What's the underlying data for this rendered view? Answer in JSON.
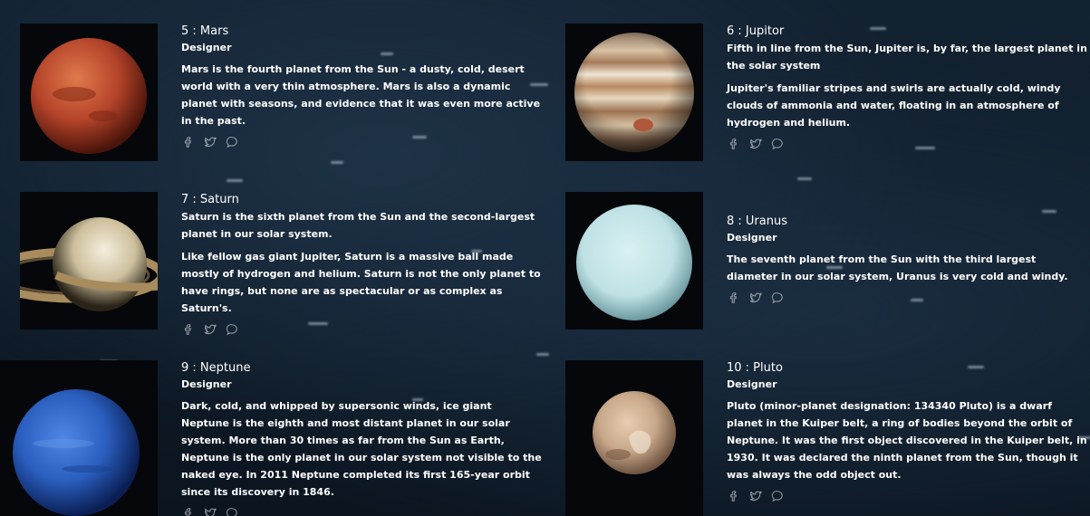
{
  "cards": [
    {
      "title": "5 : Mars",
      "role": "Designer",
      "paragraphs": [
        "Mars is the fourth planet from the Sun - a dusty, cold, desert world with a very thin atmosphere. Mars is also a dynamic planet with seasons, and evidence that it was even more active in the past."
      ]
    },
    {
      "title": "6 : Jupitor",
      "paragraphs": [
        "Fifth in line from the Sun, Jupiter is, by far, the largest planet in the solar system",
        "Jupiter's familiar stripes and swirls are actually cold, windy clouds of ammonia and water, floating in an atmosphere of hydrogen and helium."
      ]
    },
    {
      "title": "7 : Saturn",
      "paragraphs": [
        "Saturn is the sixth planet from the Sun and the second-largest planet in our solar system.",
        "Like fellow gas giant Jupiter, Saturn is a massive ball made mostly of hydrogen and helium. Saturn is not the only planet to have rings, but none are as spectacular or as complex as Saturn's."
      ]
    },
    {
      "title": "8 : Uranus",
      "role": "Designer",
      "paragraphs": [
        "The seventh planet from the Sun with the third largest diameter in our solar system, Uranus is very cold and windy."
      ]
    },
    {
      "title": "9 : Neptune",
      "role": "Designer",
      "paragraphs": [
        "Dark, cold, and whipped by supersonic winds, ice giant Neptune is the eighth and most distant planet in our solar system. More than 30 times as far from the Sun as Earth, Neptune is the only planet in our solar system not visible to the naked eye. In 2011 Neptune completed its first 165-year orbit since its discovery in 1846."
      ]
    },
    {
      "title": "10 : Pluto",
      "role": "Designer",
      "paragraphs": [
        "Pluto (minor-planet designation: 134340 Pluto) is a dwarf planet in the Kuiper belt, a ring of bodies beyond the orbit of Neptune. It was the first object discovered in the Kuiper belt, in 1930. It was declared the ninth planet from the Sun, though it was always the odd object out."
      ]
    }
  ],
  "icons": [
    "facebook-icon",
    "twitter-icon",
    "comment-icon"
  ],
  "colors": {
    "text": "#ffffff",
    "background": "#132231",
    "mars": "#b5442a",
    "jupiter": "#c9a57e",
    "saturn": "#e6dcc3",
    "uranus": "#c7e8ea",
    "neptune": "#2a5fbf",
    "pluto": "#c8a88a"
  }
}
